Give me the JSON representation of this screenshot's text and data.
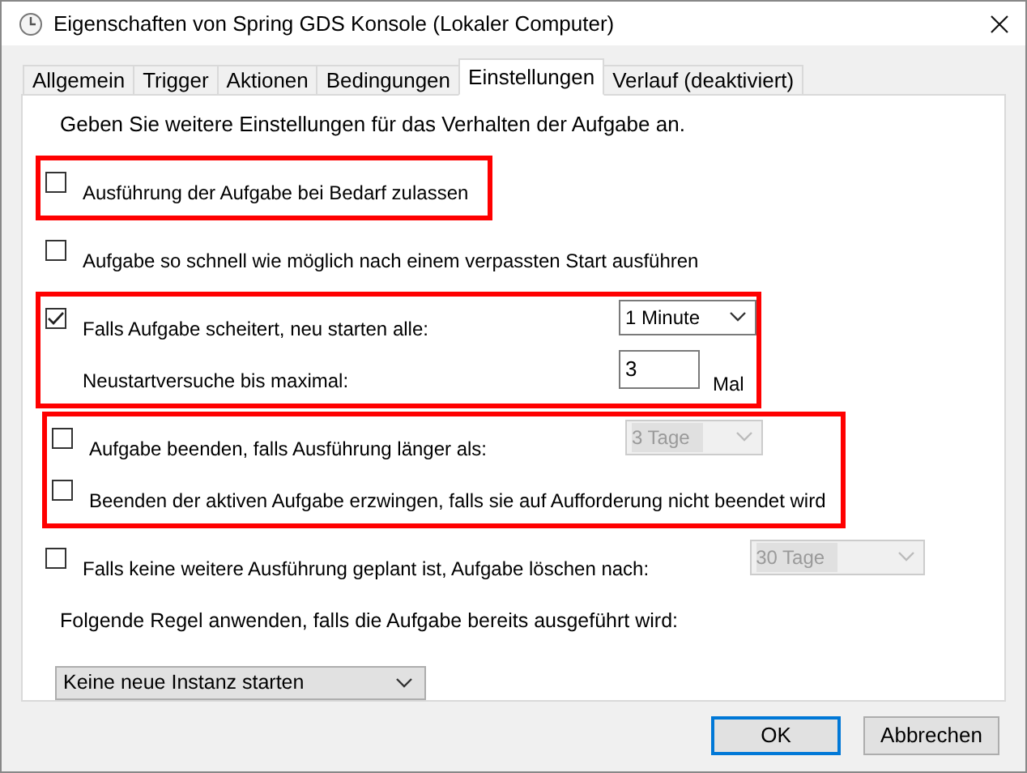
{
  "window": {
    "title": "Eigenschaften von Spring GDS Konsole (Lokaler Computer)"
  },
  "tabs": [
    {
      "label": "Allgemein",
      "selected": false
    },
    {
      "label": "Trigger",
      "selected": false
    },
    {
      "label": "Aktionen",
      "selected": false
    },
    {
      "label": "Bedingungen",
      "selected": false
    },
    {
      "label": "Einstellungen",
      "selected": true
    },
    {
      "label": "Verlauf (deaktiviert)",
      "selected": false
    }
  ],
  "description": "Geben Sie weitere Einstellungen für das Verhalten der Aufgabe an.",
  "sections": [
    {
      "highlighted": true,
      "rows": [
        {
          "kind": "checkbox",
          "label": "Ausführung der Aufgabe bei Bedarf zulassen",
          "checked": false
        }
      ]
    },
    {
      "highlighted": false,
      "rows": [
        {
          "kind": "checkbox",
          "label": "Aufgabe so schnell wie möglich nach einem verpassten Start ausführen",
          "checked": false
        }
      ]
    },
    {
      "highlighted": true,
      "rows": [
        {
          "kind": "checkbox",
          "label": "Falls Aufgabe scheitert, neu starten alle:",
          "checked": true,
          "select": {
            "value": "1 Minute",
            "disabled": false
          }
        },
        {
          "kind": "number",
          "label": "Neustartversuche bis maximal:",
          "value": "3",
          "unit": "Mal"
        }
      ]
    },
    {
      "highlighted": true,
      "rows": [
        {
          "kind": "checkbox",
          "label": "Aufgabe beenden, falls Ausführung länger als:",
          "checked": false,
          "select": {
            "value": "3 Tage",
            "disabled": true
          }
        },
        {
          "kind": "checkbox",
          "label": "Beenden der aktiven Aufgabe erzwingen, falls sie auf Aufforderung nicht beendet wird",
          "checked": false
        }
      ]
    },
    {
      "highlighted": false,
      "rows": [
        {
          "kind": "checkbox",
          "label": "Falls keine weitere Ausführung geplant ist, Aufgabe löschen nach:",
          "checked": false,
          "select": {
            "value": "30 Tage",
            "disabled": true
          }
        }
      ]
    }
  ],
  "rule_label": "Folgende Regel anwenden, falls die Aufgabe bereits ausgeführt wird:",
  "rule_select": {
    "value": "Keine neue Instanz starten"
  },
  "buttons": [
    {
      "label": "OK",
      "default": true
    },
    {
      "label": "Abbrechen",
      "default": false
    }
  ]
}
